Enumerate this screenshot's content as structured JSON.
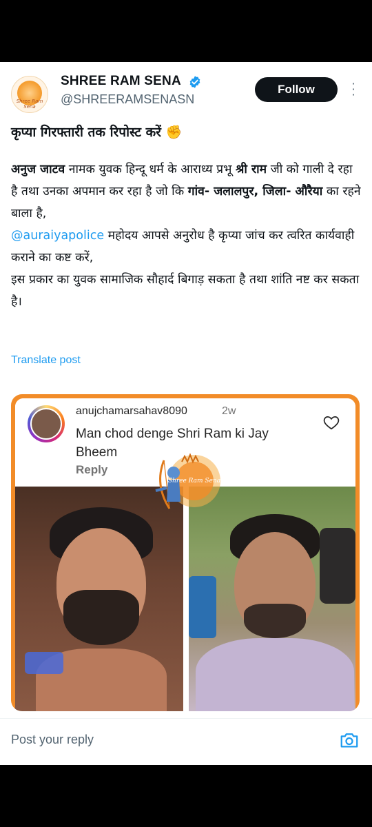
{
  "account": {
    "name": "SHREE RAM SENA",
    "handle": "@SHREERAMSENASN",
    "avatar_text": "Shree Ram Sena"
  },
  "header": {
    "follow_label": "Follow"
  },
  "post": {
    "line1": "कृप्या गिरफ्तारी तक रिपोस्ट करें ✊",
    "p_seg1_bold": "अनुज जाटव",
    "p_seg2": " नामक युवक हिन्दू धर्म के आराध्य प्रभू ",
    "p_seg3_bold": "श्री राम",
    "p_seg4": " जी को गाली दे रहा है तथा उनका अपमान कर रहा है जो कि ",
    "p_seg5_bold": "गांव- जलालपुर, जिला- औरैया",
    "p_seg6": " का रहने बाला है,",
    "mention": "@auraiyapolice",
    "p_seg7": " महोदय आपसे अनुरोध है कृप्या जांच कर त्वरित कार्यवाही कराने का कष्ट करें,",
    "p_seg8": "इस प्रकार का युवक सामाजिक सौहार्द बिगाड़ सकता है तथा शांति नष्ट कर सकता है।",
    "translate_label": "Translate post"
  },
  "media": {
    "comment_user": "anujchamarsahav8090",
    "comment_time": "2w",
    "comment_text": "Man chod denge Shri Ram ki Jay Bheem",
    "comment_reply": "Reply",
    "logo_text": "Shree Ram Sena"
  },
  "reply_bar": {
    "placeholder": "Post your reply"
  },
  "colors": {
    "accent_blue": "#1d9bf0",
    "follow_bg": "#0f1419",
    "media_border": "#f28c28"
  }
}
